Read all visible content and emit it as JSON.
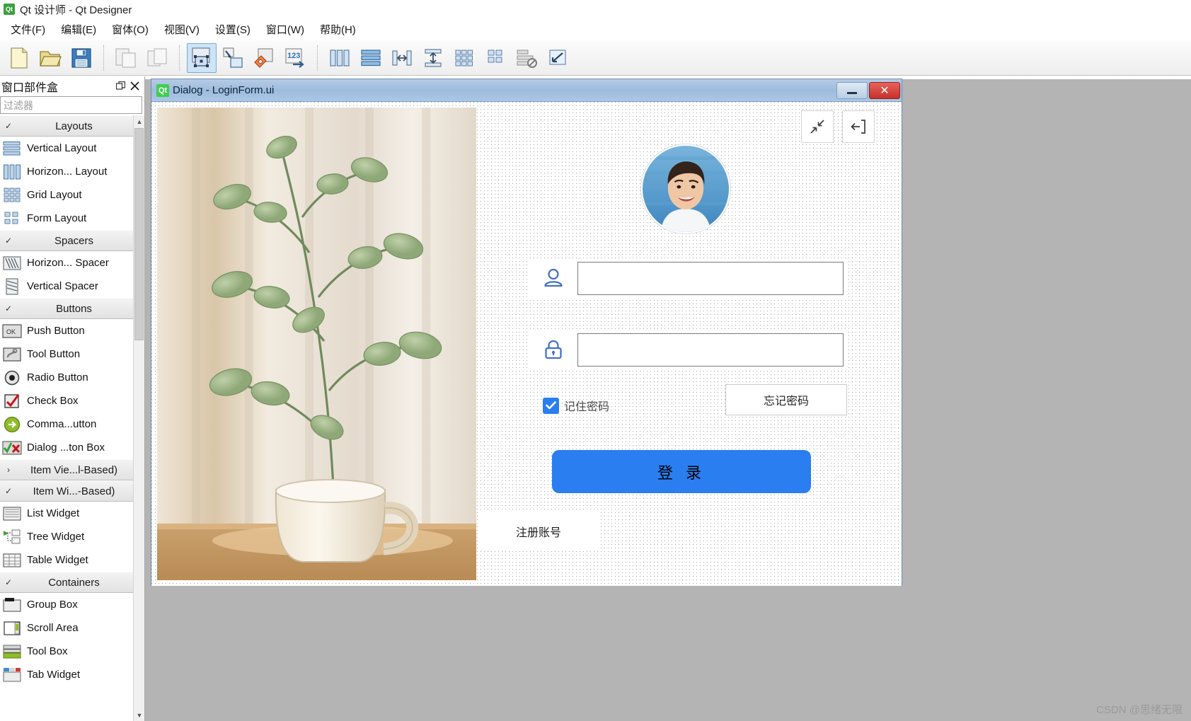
{
  "app": {
    "title": "Qt 设计师 - Qt Designer",
    "logo_text": "Qt",
    "menus": [
      {
        "label": "文件(F)",
        "name": "menu-file"
      },
      {
        "label": "编辑(E)",
        "name": "menu-edit"
      },
      {
        "label": "窗体(O)",
        "name": "menu-form"
      },
      {
        "label": "视图(V)",
        "name": "menu-view"
      },
      {
        "label": "设置(S)",
        "name": "menu-settings"
      },
      {
        "label": "窗口(W)",
        "name": "menu-window"
      },
      {
        "label": "帮助(H)",
        "name": "menu-help"
      }
    ]
  },
  "toolbar": {
    "items": [
      {
        "icon": "new-file-icon",
        "active": false
      },
      {
        "icon": "open-folder-icon",
        "active": false
      },
      {
        "icon": "save-icon",
        "active": false
      },
      {
        "icon": "separator"
      },
      {
        "icon": "undo-icon",
        "active": false
      },
      {
        "icon": "redo-icon",
        "active": false
      },
      {
        "icon": "separator"
      },
      {
        "icon": "edit-widgets-icon",
        "active": true
      },
      {
        "icon": "edit-signals-slots-icon",
        "active": false
      },
      {
        "icon": "edit-buddies-icon",
        "active": false
      },
      {
        "icon": "edit-tab-order-icon",
        "active": false
      },
      {
        "icon": "separator"
      },
      {
        "icon": "layout-horizontally-icon",
        "active": false
      },
      {
        "icon": "layout-vertically-icon",
        "active": false
      },
      {
        "icon": "layout-splitter-h-icon",
        "active": false
      },
      {
        "icon": "layout-splitter-v-icon",
        "active": false
      },
      {
        "icon": "layout-grid-icon",
        "active": false
      },
      {
        "icon": "layout-form-icon",
        "active": false
      },
      {
        "icon": "break-layout-icon",
        "active": false
      },
      {
        "icon": "adjust-size-icon",
        "active": false
      }
    ]
  },
  "widget_box": {
    "title": "窗口部件盒",
    "float_button": "float-icon",
    "close_button": "close-icon",
    "filter_placeholder": "过滤器",
    "groups": [
      {
        "label": "Layouts",
        "expanded": true,
        "name": "group-layouts",
        "items": [
          {
            "label": "Vertical Layout",
            "icon": "vertical-layout-icon"
          },
          {
            "label": "Horizon... Layout",
            "icon": "horizontal-layout-icon"
          },
          {
            "label": "Grid Layout",
            "icon": "grid-layout-icon"
          },
          {
            "label": "Form Layout",
            "icon": "form-layout-icon"
          }
        ]
      },
      {
        "label": "Spacers",
        "expanded": true,
        "name": "group-spacers",
        "items": [
          {
            "label": "Horizon... Spacer",
            "icon": "horizontal-spacer-icon"
          },
          {
            "label": "Vertical Spacer",
            "icon": "vertical-spacer-icon"
          }
        ]
      },
      {
        "label": "Buttons",
        "expanded": true,
        "name": "group-buttons",
        "items": [
          {
            "label": "Push Button",
            "icon": "push-button-icon"
          },
          {
            "label": "Tool Button",
            "icon": "tool-button-icon"
          },
          {
            "label": "Radio Button",
            "icon": "radio-button-icon"
          },
          {
            "label": "Check Box",
            "icon": "check-box-icon"
          },
          {
            "label": "Comma...utton",
            "icon": "command-link-button-icon"
          },
          {
            "label": "Dialog ...ton Box",
            "icon": "dialog-button-box-icon"
          }
        ]
      },
      {
        "label": "Item Vie...l-Based)",
        "expanded": false,
        "name": "group-item-views",
        "items": []
      },
      {
        "label": "Item Wi...-Based)",
        "expanded": true,
        "name": "group-item-widgets",
        "items": [
          {
            "label": "List Widget",
            "icon": "list-widget-icon"
          },
          {
            "label": "Tree Widget",
            "icon": "tree-widget-icon"
          },
          {
            "label": "Table Widget",
            "icon": "table-widget-icon"
          }
        ]
      },
      {
        "label": "Containers",
        "expanded": true,
        "name": "group-containers",
        "items": [
          {
            "label": "Group Box",
            "icon": "group-box-icon"
          },
          {
            "label": "Scroll Area",
            "icon": "scroll-area-icon"
          },
          {
            "label": "Tool Box",
            "icon": "tool-box-icon"
          },
          {
            "label": "Tab Widget",
            "icon": "tab-widget-icon"
          }
        ]
      }
    ]
  },
  "dialog": {
    "logo_text": "Qt",
    "title": "Dialog - LoginForm.ui",
    "minimize_label": "minimize-icon",
    "close_label": "✕",
    "toolbuttons": [
      {
        "name": "shrink-button",
        "icon": "shrink-arrows-icon"
      },
      {
        "name": "exit-button",
        "icon": "exit-door-icon"
      }
    ],
    "avatar_name": "user-avatar",
    "fields": [
      {
        "name": "username-field",
        "icon": "person-icon",
        "value": "",
        "placeholder": ""
      },
      {
        "name": "password-field",
        "icon": "lock-icon",
        "value": "",
        "placeholder": ""
      }
    ],
    "remember": {
      "label": "记住密码",
      "checked": true
    },
    "forgot_label": "忘记密码",
    "login_label": "登 录",
    "register_label": "注册账号"
  },
  "watermark": "CSDN @思绪无限",
  "colors": {
    "accent_blue": "#2a7ef0",
    "icon_blue": "#4472c4",
    "titlebar_blue": "#9dbcdd",
    "close_red": "#c5302a",
    "qt_green": "#41cd52"
  }
}
